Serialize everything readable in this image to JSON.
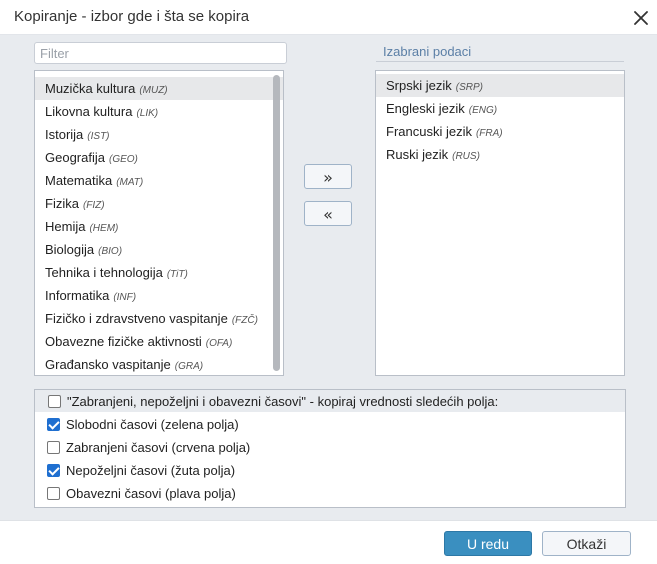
{
  "dialog": {
    "title": "Kopiranje - izbor gde i šta se kopira",
    "close_icon": "close-icon"
  },
  "filter": {
    "placeholder": "Filter",
    "value": ""
  },
  "available": {
    "items": [
      {
        "name": "Muzička kultura",
        "code": "(MUZ)",
        "selected": true
      },
      {
        "name": "Likovna kultura",
        "code": "(LIK)"
      },
      {
        "name": "Istorija",
        "code": "(IST)"
      },
      {
        "name": "Geografija",
        "code": "(GEO)"
      },
      {
        "name": "Matematika",
        "code": "(MAT)"
      },
      {
        "name": "Fizika",
        "code": "(FIZ)"
      },
      {
        "name": "Hemija",
        "code": "(HEM)"
      },
      {
        "name": "Biologija",
        "code": "(BIO)"
      },
      {
        "name": "Tehnika i tehnologija",
        "code": "(TiT)"
      },
      {
        "name": "Informatika",
        "code": "(INF)"
      },
      {
        "name": "Fizičko i zdravstveno vaspitanje",
        "code": "(FZČ)"
      },
      {
        "name": "Obavezne fizičke aktivnosti",
        "code": "(OFA)"
      },
      {
        "name": "Građansko vaspitanje",
        "code": "(GRA)"
      }
    ]
  },
  "selected_list": {
    "header": "Izabrani podaci",
    "items": [
      {
        "name": "Srpski jezik",
        "code": "(SRP)",
        "selected": true
      },
      {
        "name": "Engleski jezik",
        "code": "(ENG)"
      },
      {
        "name": "Francuski jezik",
        "code": "(FRA)"
      },
      {
        "name": "Ruski jezik",
        "code": "(RUS)"
      }
    ]
  },
  "move": {
    "add_label": "»",
    "remove_label": "«"
  },
  "copy_options": {
    "master": {
      "label": "\"Zabranjeni, nepoželjni i obavezni časovi\" - kopiraj vrednosti sledećih polja:",
      "checked": false
    },
    "options": [
      {
        "label": "Slobodni časovi (zelena polja)",
        "checked": true
      },
      {
        "label": "Zabranjeni časovi (crvena polja)",
        "checked": false
      },
      {
        "label": "Nepoželjni časovi (žuta polja)",
        "checked": true
      },
      {
        "label": "Obavezni časovi (plava polja)",
        "checked": false
      }
    ]
  },
  "footer": {
    "ok_label": "U redu",
    "cancel_label": "Otkaži"
  },
  "colors": {
    "accent": "#3a8fc0",
    "checkbox": "#1f6fd0",
    "header_text": "#5b7fa6"
  }
}
